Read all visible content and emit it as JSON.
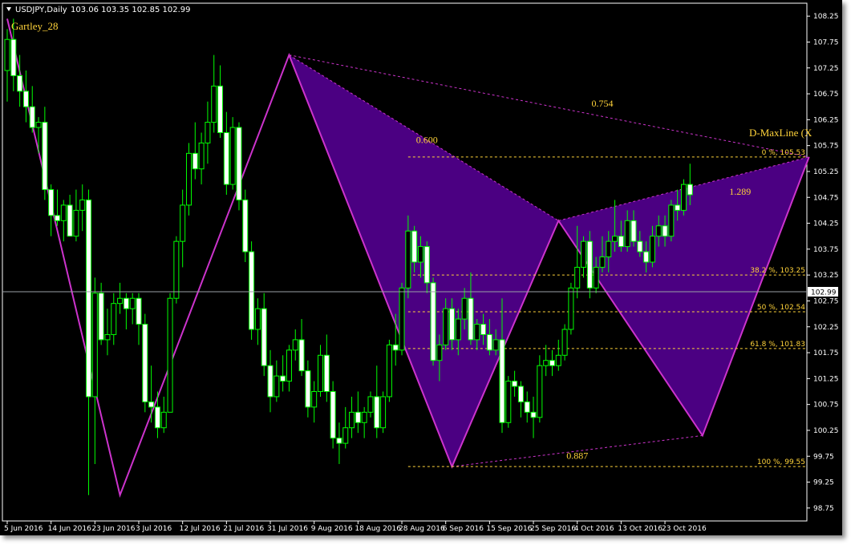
{
  "header": {
    "symbol": "USDJPY,Daily",
    "ohlc": "103.06 103.35 102.85 102.99"
  },
  "pattern_name": "Gartley_28",
  "maxline_label": "D-MaxLine (X",
  "current_price": "102.99",
  "colors": {
    "background": "#000000",
    "bull": "#00ff00",
    "bear": "#ffffff",
    "pattern_fill": "#4b0082",
    "pattern_edge": "#cc33cc",
    "label": "#ffd33a"
  },
  "chart_data": {
    "type": "candlestick",
    "ylim": [
      98.5,
      108.5
    ],
    "y_ticks": [
      "108.25",
      "107.75",
      "107.25",
      "106.75",
      "106.25",
      "105.75",
      "105.25",
      "104.75",
      "104.25",
      "103.75",
      "103.25",
      "102.75",
      "102.25",
      "101.75",
      "101.25",
      "100.75",
      "100.25",
      "99.75",
      "99.25",
      "98.75"
    ],
    "x_ticks": [
      {
        "label": "5 Jun 2016",
        "i": 0
      },
      {
        "label": "14 Jun 2016",
        "i": 7
      },
      {
        "label": "23 Jun 2016",
        "i": 14
      },
      {
        "label": "3 Jul 2016",
        "i": 21
      },
      {
        "label": "12 Jul 2016",
        "i": 28
      },
      {
        "label": "21 Jul 2016",
        "i": 35
      },
      {
        "label": "31 Jul 2016",
        "i": 42
      },
      {
        "label": "9 Aug 2016",
        "i": 49
      },
      {
        "label": "18 Aug 2016",
        "i": 56
      },
      {
        "label": "28 Aug 2016",
        "i": 63
      },
      {
        "label": "6 Sep 2016",
        "i": 70
      },
      {
        "label": "15 Sep 2016",
        "i": 77
      },
      {
        "label": "25 Sep 2016",
        "i": 84
      },
      {
        "label": "4 Oct 2016",
        "i": 91
      },
      {
        "label": "13 Oct 2016",
        "i": 98
      },
      {
        "label": "23 Oct 2016",
        "i": 105
      }
    ],
    "candles": [
      {
        "o": 107.2,
        "h": 108.0,
        "l": 106.6,
        "c": 107.8
      },
      {
        "o": 107.8,
        "h": 108.2,
        "l": 106.8,
        "c": 107.1
      },
      {
        "o": 107.1,
        "h": 107.5,
        "l": 106.5,
        "c": 106.8
      },
      {
        "o": 106.8,
        "h": 107.2,
        "l": 106.2,
        "c": 106.5
      },
      {
        "o": 106.5,
        "h": 106.9,
        "l": 106.0,
        "c": 106.1
      },
      {
        "o": 106.1,
        "h": 106.3,
        "l": 105.6,
        "c": 106.2
      },
      {
        "o": 106.2,
        "h": 106.5,
        "l": 104.7,
        "c": 104.9
      },
      {
        "o": 104.9,
        "h": 105.0,
        "l": 104.0,
        "c": 104.4
      },
      {
        "o": 104.4,
        "h": 104.9,
        "l": 104.2,
        "c": 104.3
      },
      {
        "o": 104.3,
        "h": 104.7,
        "l": 103.9,
        "c": 104.6
      },
      {
        "o": 104.6,
        "h": 104.8,
        "l": 104.0,
        "c": 104.0
      },
      {
        "o": 104.0,
        "h": 104.9,
        "l": 103.9,
        "c": 104.5
      },
      {
        "o": 104.5,
        "h": 105.0,
        "l": 104.1,
        "c": 104.7
      },
      {
        "o": 104.7,
        "h": 104.9,
        "l": 99.0,
        "c": 100.9
      },
      {
        "o": 100.9,
        "h": 103.2,
        "l": 99.6,
        "c": 102.9
      },
      {
        "o": 102.9,
        "h": 103.1,
        "l": 101.9,
        "c": 102.0
      },
      {
        "o": 102.0,
        "h": 102.6,
        "l": 101.7,
        "c": 102.1
      },
      {
        "o": 102.1,
        "h": 102.9,
        "l": 101.9,
        "c": 102.7
      },
      {
        "o": 102.7,
        "h": 103.1,
        "l": 102.5,
        "c": 102.8
      },
      {
        "o": 102.8,
        "h": 102.9,
        "l": 102.2,
        "c": 102.6
      },
      {
        "o": 102.6,
        "h": 102.9,
        "l": 102.3,
        "c": 102.8
      },
      {
        "o": 102.8,
        "h": 102.9,
        "l": 101.9,
        "c": 102.3
      },
      {
        "o": 102.3,
        "h": 102.5,
        "l": 100.6,
        "c": 100.8
      },
      {
        "o": 100.8,
        "h": 101.5,
        "l": 100.4,
        "c": 100.7
      },
      {
        "o": 100.7,
        "h": 101.0,
        "l": 100.1,
        "c": 100.3
      },
      {
        "o": 100.3,
        "h": 100.9,
        "l": 100.2,
        "c": 100.6
      },
      {
        "o": 100.6,
        "h": 102.9,
        "l": 100.6,
        "c": 102.8
      },
      {
        "o": 102.8,
        "h": 104.0,
        "l": 102.7,
        "c": 103.9
      },
      {
        "o": 103.9,
        "h": 104.9,
        "l": 103.4,
        "c": 104.6
      },
      {
        "o": 104.6,
        "h": 105.8,
        "l": 104.4,
        "c": 105.6
      },
      {
        "o": 105.6,
        "h": 106.2,
        "l": 105.1,
        "c": 105.3
      },
      {
        "o": 105.3,
        "h": 106.0,
        "l": 105.0,
        "c": 105.8
      },
      {
        "o": 105.8,
        "h": 106.6,
        "l": 105.4,
        "c": 106.2
      },
      {
        "o": 106.2,
        "h": 107.5,
        "l": 106.0,
        "c": 106.9
      },
      {
        "o": 106.9,
        "h": 107.3,
        "l": 105.9,
        "c": 106.0
      },
      {
        "o": 106.0,
        "h": 106.4,
        "l": 104.8,
        "c": 105.0
      },
      {
        "o": 105.0,
        "h": 106.3,
        "l": 104.9,
        "c": 106.1
      },
      {
        "o": 106.1,
        "h": 106.2,
        "l": 104.5,
        "c": 104.7
      },
      {
        "o": 104.7,
        "h": 104.9,
        "l": 103.5,
        "c": 103.7
      },
      {
        "o": 103.7,
        "h": 103.9,
        "l": 102.0,
        "c": 102.2
      },
      {
        "o": 102.2,
        "h": 102.8,
        "l": 101.9,
        "c": 102.6
      },
      {
        "o": 102.6,
        "h": 102.9,
        "l": 101.3,
        "c": 101.5
      },
      {
        "o": 101.5,
        "h": 101.8,
        "l": 100.6,
        "c": 100.9
      },
      {
        "o": 100.9,
        "h": 101.6,
        "l": 100.8,
        "c": 101.3
      },
      {
        "o": 101.3,
        "h": 101.7,
        "l": 101.0,
        "c": 101.2
      },
      {
        "o": 101.2,
        "h": 101.9,
        "l": 101.0,
        "c": 101.8
      },
      {
        "o": 101.8,
        "h": 102.2,
        "l": 101.6,
        "c": 102.0
      },
      {
        "o": 102.0,
        "h": 102.4,
        "l": 101.3,
        "c": 101.4
      },
      {
        "o": 101.4,
        "h": 101.6,
        "l": 100.5,
        "c": 100.7
      },
      {
        "o": 100.7,
        "h": 101.2,
        "l": 100.4,
        "c": 101.0
      },
      {
        "o": 101.0,
        "h": 101.9,
        "l": 100.9,
        "c": 101.7
      },
      {
        "o": 101.7,
        "h": 102.1,
        "l": 100.8,
        "c": 101.0
      },
      {
        "o": 101.0,
        "h": 101.2,
        "l": 99.9,
        "c": 100.1
      },
      {
        "o": 100.1,
        "h": 100.4,
        "l": 99.6,
        "c": 100.0
      },
      {
        "o": 100.0,
        "h": 100.7,
        "l": 99.9,
        "c": 100.3
      },
      {
        "o": 100.3,
        "h": 100.9,
        "l": 100.1,
        "c": 100.6
      },
      {
        "o": 100.6,
        "h": 101.0,
        "l": 100.2,
        "c": 100.4
      },
      {
        "o": 100.4,
        "h": 100.7,
        "l": 100.1,
        "c": 100.6
      },
      {
        "o": 100.6,
        "h": 101.0,
        "l": 100.5,
        "c": 100.9
      },
      {
        "o": 100.9,
        "h": 101.5,
        "l": 100.1,
        "c": 100.3
      },
      {
        "o": 100.3,
        "h": 101.0,
        "l": 100.2,
        "c": 100.9
      },
      {
        "o": 100.9,
        "h": 102.0,
        "l": 100.8,
        "c": 101.9
      },
      {
        "o": 101.9,
        "h": 102.5,
        "l": 101.5,
        "c": 101.8
      },
      {
        "o": 101.8,
        "h": 103.1,
        "l": 101.7,
        "c": 103.0
      },
      {
        "o": 103.0,
        "h": 104.4,
        "l": 102.8,
        "c": 104.1
      },
      {
        "o": 104.1,
        "h": 104.2,
        "l": 103.3,
        "c": 103.5
      },
      {
        "o": 103.5,
        "h": 104.0,
        "l": 103.2,
        "c": 103.8
      },
      {
        "o": 103.8,
        "h": 103.9,
        "l": 102.9,
        "c": 103.1
      },
      {
        "o": 103.1,
        "h": 103.2,
        "l": 101.5,
        "c": 101.6
      },
      {
        "o": 101.6,
        "h": 102.1,
        "l": 101.2,
        "c": 101.9
      },
      {
        "o": 101.9,
        "h": 102.8,
        "l": 101.8,
        "c": 102.6
      },
      {
        "o": 102.6,
        "h": 102.8,
        "l": 101.8,
        "c": 102.0
      },
      {
        "o": 102.0,
        "h": 102.6,
        "l": 101.7,
        "c": 102.4
      },
      {
        "o": 102.4,
        "h": 103.0,
        "l": 102.2,
        "c": 102.8
      },
      {
        "o": 102.8,
        "h": 103.3,
        "l": 101.9,
        "c": 102.0
      },
      {
        "o": 102.0,
        "h": 102.4,
        "l": 101.8,
        "c": 102.3
      },
      {
        "o": 102.3,
        "h": 102.5,
        "l": 101.9,
        "c": 102.1
      },
      {
        "o": 102.1,
        "h": 102.4,
        "l": 101.7,
        "c": 101.8
      },
      {
        "o": 101.8,
        "h": 102.2,
        "l": 101.7,
        "c": 102.0
      },
      {
        "o": 102.0,
        "h": 102.8,
        "l": 100.2,
        "c": 100.4
      },
      {
        "o": 100.4,
        "h": 101.3,
        "l": 100.3,
        "c": 101.2
      },
      {
        "o": 101.2,
        "h": 101.4,
        "l": 100.9,
        "c": 101.1
      },
      {
        "o": 101.1,
        "h": 101.2,
        "l": 100.5,
        "c": 100.8
      },
      {
        "o": 100.8,
        "h": 101.0,
        "l": 100.4,
        "c": 100.6
      },
      {
        "o": 100.6,
        "h": 100.9,
        "l": 100.1,
        "c": 100.5
      },
      {
        "o": 100.5,
        "h": 101.7,
        "l": 100.4,
        "c": 101.5
      },
      {
        "o": 101.5,
        "h": 101.9,
        "l": 101.3,
        "c": 101.6
      },
      {
        "o": 101.6,
        "h": 101.8,
        "l": 101.3,
        "c": 101.5
      },
      {
        "o": 101.5,
        "h": 102.0,
        "l": 101.4,
        "c": 101.7
      },
      {
        "o": 101.7,
        "h": 102.3,
        "l": 101.6,
        "c": 102.2
      },
      {
        "o": 102.2,
        "h": 103.1,
        "l": 102.1,
        "c": 103.0
      },
      {
        "o": 103.0,
        "h": 104.2,
        "l": 102.8,
        "c": 103.4
      },
      {
        "o": 103.4,
        "h": 104.0,
        "l": 103.2,
        "c": 103.9
      },
      {
        "o": 103.9,
        "h": 104.1,
        "l": 102.8,
        "c": 103.0
      },
      {
        "o": 103.0,
        "h": 103.6,
        "l": 102.9,
        "c": 103.4
      },
      {
        "o": 103.4,
        "h": 104.0,
        "l": 103.3,
        "c": 103.6
      },
      {
        "o": 103.6,
        "h": 104.1,
        "l": 103.3,
        "c": 103.9
      },
      {
        "o": 103.9,
        "h": 104.7,
        "l": 103.7,
        "c": 104.0
      },
      {
        "o": 104.0,
        "h": 104.3,
        "l": 103.7,
        "c": 103.8
      },
      {
        "o": 103.8,
        "h": 104.5,
        "l": 103.7,
        "c": 104.3
      },
      {
        "o": 104.3,
        "h": 104.5,
        "l": 103.8,
        "c": 103.9
      },
      {
        "o": 103.9,
        "h": 104.1,
        "l": 103.6,
        "c": 103.7
      },
      {
        "o": 103.7,
        "h": 103.9,
        "l": 103.3,
        "c": 103.5
      },
      {
        "o": 103.5,
        "h": 104.2,
        "l": 103.4,
        "c": 104.0
      },
      {
        "o": 104.0,
        "h": 104.4,
        "l": 103.8,
        "c": 104.2
      },
      {
        "o": 104.2,
        "h": 104.4,
        "l": 103.8,
        "c": 104.0
      },
      {
        "o": 104.0,
        "h": 104.7,
        "l": 103.9,
        "c": 104.6
      },
      {
        "o": 104.6,
        "h": 104.9,
        "l": 104.3,
        "c": 104.5
      },
      {
        "o": 104.5,
        "h": 105.1,
        "l": 104.4,
        "c": 105.0
      },
      {
        "o": 105.0,
        "h": 105.4,
        "l": 104.6,
        "c": 104.8
      }
    ],
    "pattern": {
      "points": [
        {
          "i": 0,
          "p": 108.2
        },
        {
          "i": 18,
          "p": 99.0
        },
        {
          "i": 45,
          "p": 107.5
        },
        {
          "i": 71,
          "p": 99.55
        },
        {
          "i": 88,
          "p": 104.3
        },
        {
          "i": 111,
          "p": 100.15
        },
        {
          "i": 128,
          "p": 105.53
        }
      ],
      "ratios": [
        {
          "text": "0.754",
          "i": 95,
          "p": 106.5
        },
        {
          "text": "0.600",
          "i": 67,
          "p": 105.8
        },
        {
          "text": "1.289",
          "i": 117,
          "p": 104.8
        },
        {
          "text": "0.887",
          "i": 91,
          "p": 99.7
        }
      ]
    },
    "fib_levels": [
      {
        "label": "0 %,  105.53",
        "price": 105.53
      },
      {
        "label": "38.2 %,  103.25",
        "price": 103.25
      },
      {
        "label": "50 %,  102.54",
        "price": 102.54
      },
      {
        "label": "61.8 %,  101.83",
        "price": 101.83
      },
      {
        "label": "100 %,  99.55",
        "price": 99.55
      }
    ]
  }
}
